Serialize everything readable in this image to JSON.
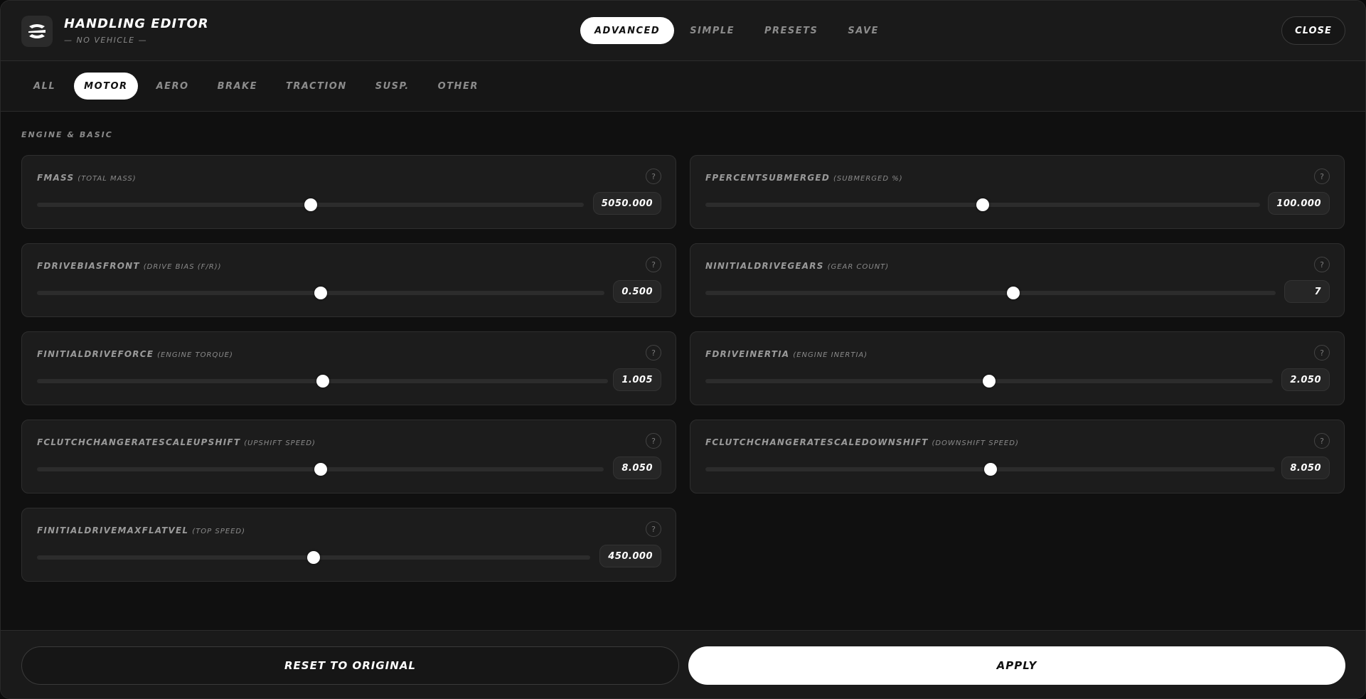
{
  "header": {
    "title": "Handling Editor",
    "subtitle": "— No Vehicle —",
    "mode_tabs": [
      "Advanced",
      "Simple",
      "Presets",
      "Save"
    ],
    "close_label": "Close",
    "logo_icon": "swirl-logo-icon"
  },
  "categories": [
    "All",
    "Motor",
    "Aero",
    "Brake",
    "Traction",
    "Susp.",
    "Other"
  ],
  "active_category": "Motor",
  "section": {
    "title": "Engine & Basic"
  },
  "fields": [
    {
      "name": "fMass",
      "desc": "(Total Mass)",
      "value": "5050.000",
      "fraction": 0.5
    },
    {
      "name": "fPercentSubmerged",
      "desc": "(Submerged %)",
      "value": "100.000",
      "fraction": 0.5
    },
    {
      "name": "fDriveBiasFront",
      "desc": "(Drive Bias (F/R))",
      "value": "0.500",
      "fraction": 0.5
    },
    {
      "name": "nInitialDriveGears",
      "desc": "(Gear Count)",
      "value": "7",
      "fraction": 0.54
    },
    {
      "name": "fInitialDriveForce",
      "desc": "(Engine Torque)",
      "value": "1.005",
      "fraction": 0.5
    },
    {
      "name": "fDriveInertia",
      "desc": "(Engine Inertia)",
      "value": "2.050",
      "fraction": 0.5
    },
    {
      "name": "fClutchChangeRateScaleUpShift",
      "desc": "(Upshift Speed)",
      "value": "8.050",
      "fraction": 0.5
    },
    {
      "name": "fClutchChangeRateScaleDownShift",
      "desc": "(Downshift Speed)",
      "value": "8.050",
      "fraction": 0.5
    },
    {
      "name": "fInitialDriveMaxFlatVel",
      "desc": "(Top Speed)",
      "value": "450.000",
      "fraction": 0.5
    }
  ],
  "help_glyph": "?",
  "footer": {
    "reset_label": "Reset to Original",
    "apply_label": "Apply"
  },
  "colors": {
    "accent": "#ffffff",
    "background": "#101010",
    "panel": "#1c1c1c"
  }
}
